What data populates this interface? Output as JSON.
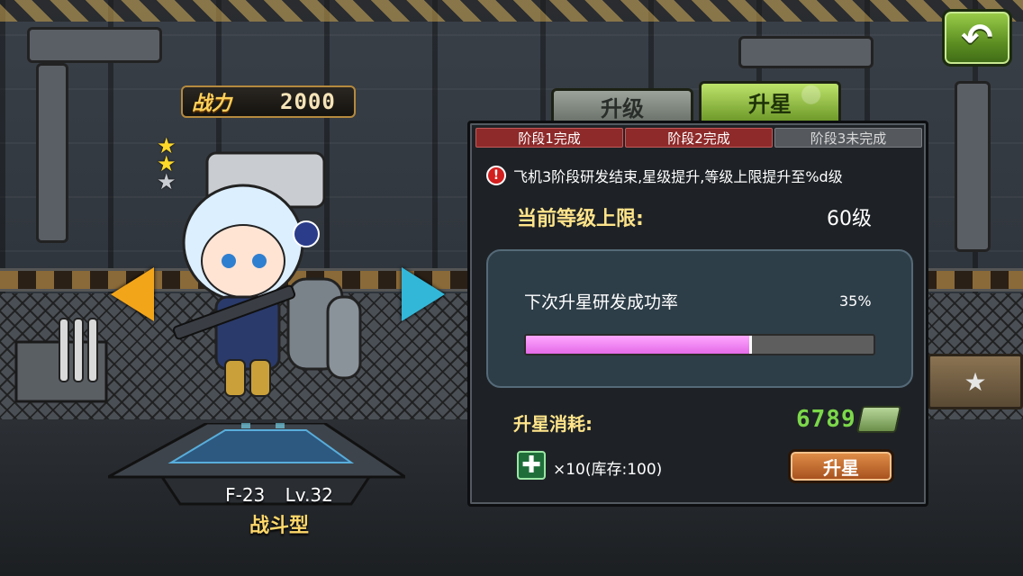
{
  "power": {
    "label": "战力",
    "value": "2000"
  },
  "stars": {
    "filled": 2,
    "total": 3
  },
  "plane": {
    "model": "F-23",
    "level": "Lv.32",
    "type": "战斗型"
  },
  "tabs": [
    {
      "label": "升级",
      "active": false
    },
    {
      "label": "升星",
      "active": true
    }
  ],
  "stages": [
    {
      "label": "阶段1完成",
      "status": "done"
    },
    {
      "label": "阶段2完成",
      "status": "done"
    },
    {
      "label": "阶段3未完成",
      "status": "pending"
    }
  ],
  "notice": "飞机3阶段研发结束,星级提升,等级上限提升至%d级",
  "level_cap": {
    "label": "当前等级上限:",
    "value": "60级"
  },
  "success": {
    "label": "下次升星研发成功率",
    "percent_text": "35%",
    "bar_fill_fraction": 0.65
  },
  "cost": {
    "label": "升星消耗:",
    "money": "6789",
    "item_text": "×10(库存:100)"
  },
  "star_button": "升星",
  "icons": {
    "back": "back-arrow-icon",
    "warn": "exclamation-icon",
    "money": "money-stack-icon",
    "item": "plus-cross-icon",
    "star": "star-icon"
  },
  "colors": {
    "power_text": "#ffd15a",
    "cost_money": "#7cd84a",
    "stage_done": "#8e2a2a",
    "stage_pending": "#55595e",
    "progress_fill": "#e46ae8",
    "star_button": "#c06a2c"
  }
}
